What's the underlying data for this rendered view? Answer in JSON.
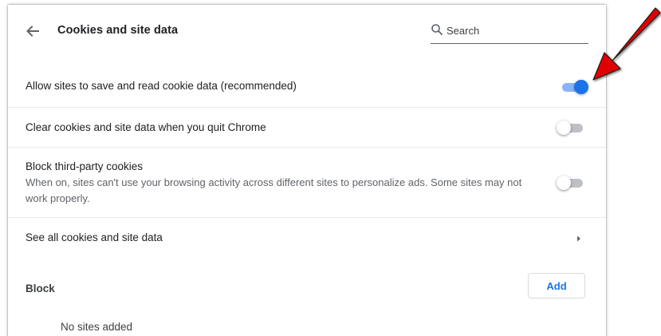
{
  "header": {
    "title": "Cookies and site data",
    "search_placeholder": "Search"
  },
  "settings": [
    {
      "label": "Allow sites to save and read cookie data (recommended)",
      "enabled": true
    },
    {
      "label": "Clear cookies and site data when you quit Chrome",
      "enabled": false
    },
    {
      "label": "Block third-party cookies",
      "description": "When on, sites can't use your browsing activity across different sites to personalize ads. Some sites may not work properly.",
      "enabled": false
    }
  ],
  "see_all": {
    "label": "See all cookies and site data"
  },
  "block_section": {
    "title": "Block",
    "add_label": "Add",
    "empty_text": "No sites added"
  },
  "colors": {
    "accent": "#1a73e8",
    "toggle_on_track": "#8ab4f8",
    "toggle_off_track": "#bdc1c6",
    "annotation_arrow": "#e00000"
  },
  "icons": {
    "back": "arrow-back-icon",
    "search": "search-icon",
    "chevron": "chevron-right-icon",
    "annotation": "red-arrow-annotation-icon"
  }
}
